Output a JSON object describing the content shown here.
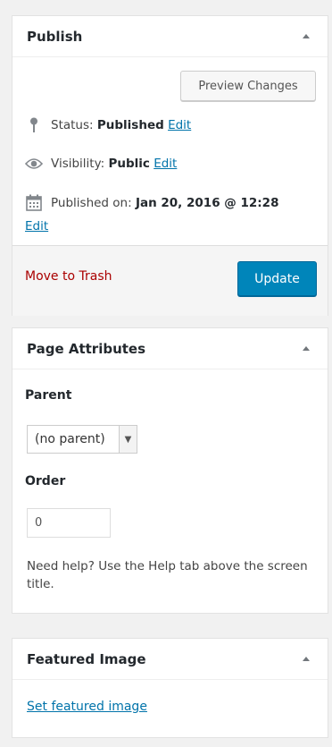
{
  "publish": {
    "title": "Publish",
    "preview_label": "Preview Changes",
    "status_label": "Status:",
    "status_value": "Published",
    "visibility_label": "Visibility:",
    "visibility_value": "Public",
    "published_on_label": "Published on:",
    "published_on_value": "Jan 20, 2016 @ 12:28",
    "edit_label": "Edit",
    "trash_label": "Move to Trash",
    "update_label": "Update"
  },
  "page_attributes": {
    "title": "Page Attributes",
    "parent_label": "Parent",
    "parent_selected": "(no parent)",
    "order_label": "Order",
    "order_value": "0",
    "help_text": "Need help? Use the Help tab above the screen title."
  },
  "featured_image": {
    "title": "Featured Image",
    "set_label": "Set featured image"
  },
  "colors": {
    "primary": "#0085ba",
    "link": "#0073aa",
    "trash": "#a00000"
  }
}
